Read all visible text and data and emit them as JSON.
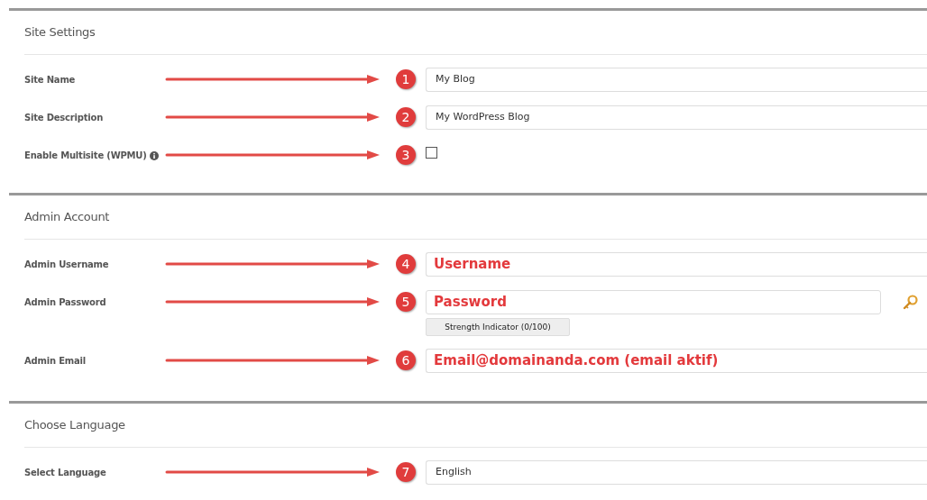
{
  "sections": [
    {
      "title": "Site Settings",
      "fields": [
        {
          "label": "Site Name",
          "marker": "1",
          "kind": "text",
          "value": "My Blog",
          "highlighted": false
        },
        {
          "label": "Site Description",
          "marker": "2",
          "kind": "text",
          "value": "My WordPress Blog",
          "highlighted": false
        },
        {
          "label": "Enable Multisite (WPMU)",
          "has_info": true,
          "marker": "3",
          "kind": "checkbox",
          "checked": false
        }
      ]
    },
    {
      "title": "Admin Account",
      "fields": [
        {
          "label": "Admin Username",
          "marker": "4",
          "kind": "text",
          "value": "Username",
          "highlighted": true
        },
        {
          "label": "Admin Password",
          "marker": "5",
          "kind": "password",
          "value": "Password",
          "highlighted": true,
          "strength": "Strength Indicator (0/100)"
        },
        {
          "label": "Admin Email",
          "marker": "6",
          "kind": "text",
          "value": "Email@domainanda.com (email aktif)",
          "highlighted": true
        }
      ]
    },
    {
      "title": "Choose Language",
      "fields": [
        {
          "label": "Select Language",
          "marker": "7",
          "kind": "select",
          "value": "English",
          "highlighted": false
        }
      ]
    }
  ]
}
